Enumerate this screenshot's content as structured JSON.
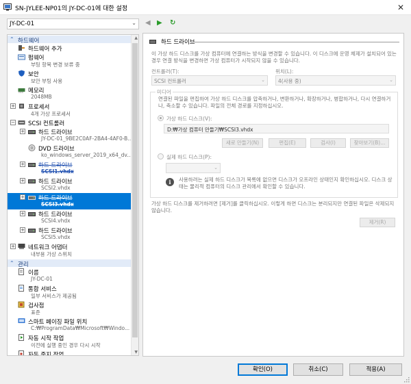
{
  "window": {
    "title": "SN-JYLEE-NP01의 JY-DC-01에 대한 설정",
    "close_glyph": "✕"
  },
  "vm_selector": {
    "value": "JY-DC-01"
  },
  "toolbar": {
    "back": "◀",
    "forward": "▶",
    "refresh": "↻"
  },
  "tree": {
    "hardware_header": "하드웨어",
    "management_header": "관리",
    "add_hardware": {
      "label": "하드웨어 추가"
    },
    "firmware": {
      "label": "펌웨어",
      "sub": "부팅 항목 변경 보류 중"
    },
    "security": {
      "label": "보안",
      "sub": "보안 부팅 사용"
    },
    "memory": {
      "label": "메모리",
      "sub": "2048MB"
    },
    "processor": {
      "label": "프로세서",
      "sub": "4개 가상 프로세서"
    },
    "scsi": {
      "label": "SCSI 컨트롤러"
    },
    "hdd1": {
      "label": "하드 드라이브",
      "sub": "JY-DC-01_9BE2C0AF-2BA4-4AF0-B..."
    },
    "dvd": {
      "label": "DVD 드라이브",
      "sub": "ko_windows_server_2019_x64_dv..."
    },
    "hdd2": {
      "label": "하드 드라이브",
      "sub": "SCSI1.vhdx"
    },
    "hdd3": {
      "label": "하드 드라이브",
      "sub": "SCSI2.vhdx"
    },
    "hdd4": {
      "label": "하드 드라이브",
      "sub": "SCSI3.vhdx"
    },
    "hdd5": {
      "label": "하드 드라이브",
      "sub": "SCSI4.vhdx"
    },
    "hdd6": {
      "label": "하드 드라이브",
      "sub": "SCSI5.vhdx"
    },
    "network": {
      "label": "네트워크 어댑터",
      "sub": "내부용 가상 스위치"
    },
    "name": {
      "label": "이름",
      "sub": "JY-DC-01"
    },
    "integration": {
      "label": "통합 서비스",
      "sub": "일부 서비스가 제공됨"
    },
    "checkpoints": {
      "label": "검사점",
      "sub": "표준"
    },
    "smart_paging": {
      "label": "스마트 페이징 파일 위치",
      "sub": "C:₩ProgramData₩Microsoft₩Windo..."
    },
    "auto_start": {
      "label": "자동 시작 작업",
      "sub": "이전에 실행 중인 경우 다시 시작"
    },
    "auto_stop": {
      "label": "자동 중지 작업",
      "sub": "저장"
    }
  },
  "panel": {
    "title": "하드 드라이브",
    "intro": "이 가상 하드 디스크를 가상 컴퓨터에 연결하는 방식을 변경할 수 있습니다. 이 디스크에 운영 체제가 설치되어 있는 경우 연결 방식을 변경하면 가상 컴퓨터가 시작되지 않을 수 있습니다.",
    "controller_label": "컨트롤러(T):",
    "controller_value": "SCSI 컨트롤러",
    "location_label": "위치(L):",
    "location_value": "4(사용 중)",
    "media_legend": "미디어",
    "media_desc": "연결된 파일을 편집하여 가상 하드 디스크를 압축하거나, 변환하거나, 확장하거나, 병합하거나, 다시 연결하거나, 축소할 수 있습니다. 파일의 전체 경로를 지정하십시오.",
    "vhd_option": "가상 하드 디스크(V):",
    "vhd_path": "D:₩가상 컴퓨터 만들기₩SCSI3.vhdx",
    "btn_new": "새로 만들기(N)",
    "btn_edit": "편집(E)",
    "btn_inspect": "검사(I)",
    "btn_browse": "찾아보기(B)...",
    "physical_option": "실제 하드 디스크(P):",
    "physical_info": "사용하려는 실제 하드 디스크가 목록에 없으면 디스크가 오프라인 상태인지 확인하십시오. 디스크 상태는 물리적 컴퓨터의 디스크 관리에서 확인할 수 있습니다.",
    "remove_desc": "가상 하드 디스크를 제거하려면 [제거]를 클릭하십시오. 이렇게 하면 디스크는 분리되지만 연결된 파일은 삭제되지 않습니다.",
    "btn_remove": "제거(R)"
  },
  "footer": {
    "ok": "확인(O)",
    "cancel": "취소(C)",
    "apply": "적용(A)"
  },
  "colors": {
    "accent": "#0078d7",
    "category_bg": "#e2ebf8",
    "category_text": "#1a3d7a"
  }
}
